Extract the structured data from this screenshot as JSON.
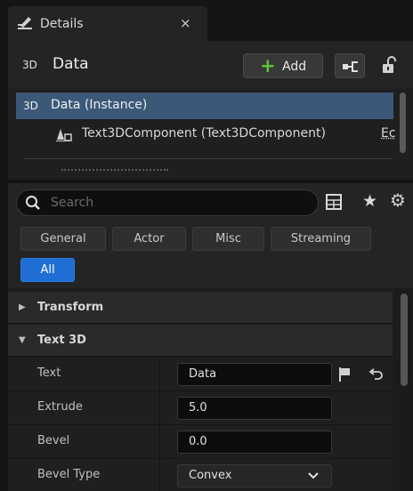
{
  "tab": {
    "title": "Details",
    "close": "×"
  },
  "header": {
    "badge": "3D",
    "actor_name": "Data",
    "add_label": "Add"
  },
  "tree": {
    "selected": {
      "badge": "3D",
      "label": "Data (Instance)"
    },
    "component": {
      "label": "Text3DComponent (Text3DComponent)",
      "edit_link": "Ec"
    }
  },
  "search": {
    "placeholder": "Search"
  },
  "filters": {
    "general": "General",
    "actor": "Actor",
    "misc": "Misc",
    "streaming": "Streaming",
    "all": "All"
  },
  "categories": {
    "transform": "Transform",
    "text3d": "Text 3D"
  },
  "properties": [
    {
      "name": "Text",
      "value": "Data"
    },
    {
      "name": "Extrude",
      "value": "5.0"
    },
    {
      "name": "Bevel",
      "value": "0.0"
    },
    {
      "name": "Bevel Type",
      "value": "Convex"
    }
  ],
  "colors": {
    "accent": "#1f6ed4",
    "selection": "#3b5878",
    "add_plus": "#5fc439"
  }
}
